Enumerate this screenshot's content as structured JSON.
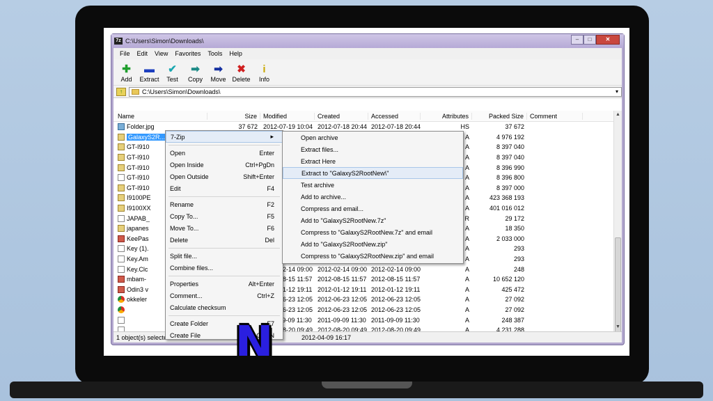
{
  "window": {
    "title": "C:\\Users\\Simon\\Downloads\\",
    "app_icon": "7z",
    "controls": [
      "–",
      "□",
      "✕"
    ]
  },
  "menu": [
    "File",
    "Edit",
    "View",
    "Favorites",
    "Tools",
    "Help"
  ],
  "toolbar": [
    {
      "label": "Add",
      "icon": "✚",
      "color": "#1e9e2c"
    },
    {
      "label": "Extract",
      "icon": "▬",
      "color": "#1c3fbf"
    },
    {
      "label": "Test",
      "icon": "✔",
      "color": "#1aa7b0"
    },
    {
      "label": "Copy",
      "icon": "➡",
      "color": "#1b8a86"
    },
    {
      "label": "Move",
      "icon": "➡",
      "color": "#142fa0"
    },
    {
      "label": "Delete",
      "icon": "✖",
      "color": "#d02020"
    },
    {
      "label": "Info",
      "icon": "i",
      "color": "#c8a800"
    }
  ],
  "address": {
    "path": "C:\\Users\\Simon\\Downloads\\",
    "dropdown": "▾"
  },
  "columns": [
    "Name",
    "Size",
    "Modified",
    "Created",
    "Accessed",
    "Attributes",
    "Packed Size",
    "Comment"
  ],
  "files": [
    {
      "icon": "img",
      "name": "Folder.jpg",
      "size": "37 672",
      "modified": "2012-07-19 10:04",
      "created": "2012-07-18 20:44",
      "accessed": "2012-07-18 20:44",
      "attr": "HS",
      "packed": "37 672"
    },
    {
      "icon": "zip",
      "name": "GalaxyS2R...New",
      "size": "",
      "modified": "",
      "created": "",
      "accessed": "",
      "attr": "A",
      "packed": "4 976 192",
      "selected": true
    },
    {
      "icon": "zip",
      "name": "GT-I910",
      "size": "",
      "modified": "",
      "created": "",
      "accessed": "",
      "attr": "A",
      "packed": "8 397 040"
    },
    {
      "icon": "zip",
      "name": "GT-I910",
      "size": "",
      "modified": "",
      "created": "",
      "accessed": "",
      "attr": "A",
      "packed": "8 397 040"
    },
    {
      "icon": "zip",
      "name": "GT-I910",
      "size": "",
      "modified": "",
      "created": "",
      "accessed": "",
      "attr": "A",
      "packed": "8 396 990"
    },
    {
      "icon": "file",
      "name": "GT-I910",
      "size": "",
      "modified": "",
      "created": "",
      "accessed": "",
      "attr": "A",
      "packed": "8 396 800"
    },
    {
      "icon": "zip",
      "name": "GT-I910",
      "size": "",
      "modified": "",
      "created": "",
      "accessed": "",
      "attr": "A",
      "packed": "8 397 000"
    },
    {
      "icon": "zip",
      "name": "I9100PE",
      "size": "",
      "modified": "",
      "created": "",
      "accessed": "",
      "attr": "A",
      "packed": "423 368 193"
    },
    {
      "icon": "zip",
      "name": "I9100XX",
      "size": "",
      "modified": "",
      "created": "",
      "accessed": "",
      "attr": "A",
      "packed": "401 016 012"
    },
    {
      "icon": "file",
      "name": "JAPAB_",
      "size": "",
      "modified": "",
      "created": "",
      "accessed": "",
      "attr": "R",
      "packed": "29 172"
    },
    {
      "icon": "zip",
      "name": "japanes",
      "size": "",
      "modified": "",
      "created": "",
      "accessed": "",
      "attr": "A",
      "packed": "18 350"
    },
    {
      "icon": "exe",
      "name": "KeePas",
      "size": "",
      "modified": "",
      "created": "",
      "accessed": "",
      "attr": "A",
      "packed": "2 033 000"
    },
    {
      "icon": "file",
      "name": "Key (1).",
      "size": "",
      "modified": "",
      "created": "",
      "accessed": "",
      "attr": "A",
      "packed": "293"
    },
    {
      "icon": "file",
      "name": "Key.Am",
      "size": "",
      "modified": "",
      "created": "",
      "accessed": "",
      "attr": "A",
      "packed": "293"
    },
    {
      "icon": "file",
      "name": "Key.Clc",
      "size": "",
      "modified": "2012-02-14 09:00",
      "created": "2012-02-14 09:00",
      "accessed": "2012-02-14 09:00",
      "attr": "A",
      "packed": "248"
    },
    {
      "icon": "exe",
      "name": "mbam-",
      "size": "",
      "modified": "2012-08-15 11:57",
      "created": "2012-08-15 11:57",
      "accessed": "2012-08-15 11:57",
      "attr": "A",
      "packed": "10 652 120"
    },
    {
      "icon": "exe",
      "name": "Odin3 v",
      "size": "",
      "modified": "2012-01-12 19:11",
      "created": "2012-01-12 19:11",
      "accessed": "2012-01-12 19:11",
      "attr": "A",
      "packed": "425 472"
    },
    {
      "icon": "chrome",
      "name": "okkeler",
      "size": "",
      "modified": "2012-06-23 12:05",
      "created": "2012-06-23 12:05",
      "accessed": "2012-06-23 12:05",
      "attr": "A",
      "packed": "27 092"
    },
    {
      "icon": "chrome",
      "name": "",
      "size": "",
      "modified": "2012-06-23 12:05",
      "created": "2012-06-23 12:05",
      "accessed": "2012-06-23 12:05",
      "attr": "A",
      "packed": "27 092"
    },
    {
      "icon": "file",
      "name": "",
      "size": "",
      "modified": "2011-09-09 11:30",
      "created": "2011-09-09 11:30",
      "accessed": "2011-09-09 11:30",
      "attr": "A",
      "packed": "248 387"
    },
    {
      "icon": "file",
      "name": "",
      "size": "",
      "modified": "2012-08-20 09:49",
      "created": "2012-08-20 09:49",
      "accessed": "2012-08-20 09:49",
      "attr": "A",
      "packed": "4 231 288"
    }
  ],
  "status": {
    "left": "1 object(s) selected",
    "date": "2012-04-09 16:17"
  },
  "context_menu": [
    {
      "label": "7-Zip",
      "key": "▸",
      "highlighted": true
    },
    {
      "sep": true
    },
    {
      "label": "Open",
      "key": "Enter"
    },
    {
      "label": "Open Inside",
      "key": "Ctrl+PgDn"
    },
    {
      "label": "Open Outside",
      "key": "Shift+Enter"
    },
    {
      "label": "Edit",
      "key": "F4"
    },
    {
      "sep": true
    },
    {
      "label": "Rename",
      "key": "F2"
    },
    {
      "label": "Copy To...",
      "key": "F5"
    },
    {
      "label": "Move To...",
      "key": "F6"
    },
    {
      "label": "Delete",
      "key": "Del"
    },
    {
      "sep": true
    },
    {
      "label": "Split file...",
      "key": ""
    },
    {
      "label": "Combine files...",
      "key": ""
    },
    {
      "sep": true
    },
    {
      "label": "Properties",
      "key": "Alt+Enter"
    },
    {
      "label": "Comment...",
      "key": "Ctrl+Z"
    },
    {
      "label": "Calculate checksum",
      "key": ""
    },
    {
      "sep": true
    },
    {
      "label": "Create Folder",
      "key": "F7"
    },
    {
      "label": "Create File",
      "key": "Ctrl+N"
    }
  ],
  "submenu": [
    {
      "label": "Open archive"
    },
    {
      "label": "Extract files..."
    },
    {
      "label": "Extract Here"
    },
    {
      "label": "Extract to \"GalaxyS2RootNew\\\"",
      "highlighted": true
    },
    {
      "label": "Test archive"
    },
    {
      "label": "Add to archive..."
    },
    {
      "label": "Compress and email..."
    },
    {
      "label": "Add to \"GalaxyS2RootNew.7z\""
    },
    {
      "label": "Compress to \"GalaxyS2RootNew.7z\" and email"
    },
    {
      "label": "Add to \"GalaxyS2RootNew.zip\""
    },
    {
      "label": "Compress to \"GalaxyS2RootNew.zip\" and email"
    }
  ],
  "logo": {
    "letter": "N",
    "color": "#2a1fe0"
  }
}
